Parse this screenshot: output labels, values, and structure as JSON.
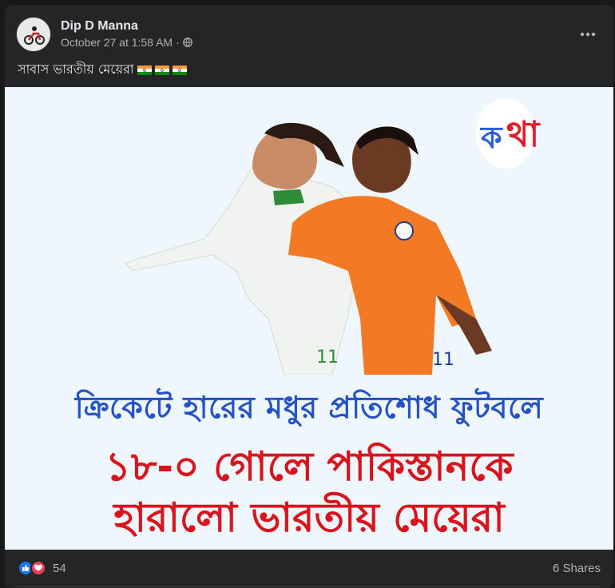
{
  "post": {
    "author_name": "Dip D Manna",
    "timestamp": "October 27 at 1:58 AM",
    "separator": "·",
    "privacy_icon": "globe-icon",
    "more_icon": "more-options-icon",
    "caption": "সাবাস ভারতীয় মেয়েরা",
    "caption_emojis": [
      "india-flag",
      "india-flag",
      "india-flag"
    ]
  },
  "image": {
    "logo_text_main": "ক",
    "logo_text_accent": "থা",
    "headline_line1": "ক্রিকেটে হারের মধুর প্রতিশোধ ফুটবলে",
    "headline_line2": "১৮-০ গোলে পাকিস্তানকে",
    "headline_line3": "হারালো ভারতীয় মেয়েরা",
    "jersey_number_white": "11",
    "jersey_number_orange": "11"
  },
  "footer": {
    "reaction_icons": [
      "like-icon",
      "love-icon"
    ],
    "reaction_count": "54",
    "shares_label": "6 Shares"
  },
  "colors": {
    "background": "#18191a",
    "card": "#242526",
    "headline_blue": "#2450c8",
    "headline_red": "#d9141c",
    "like_blue": "#1877f2",
    "love_red": "#f33e58"
  }
}
